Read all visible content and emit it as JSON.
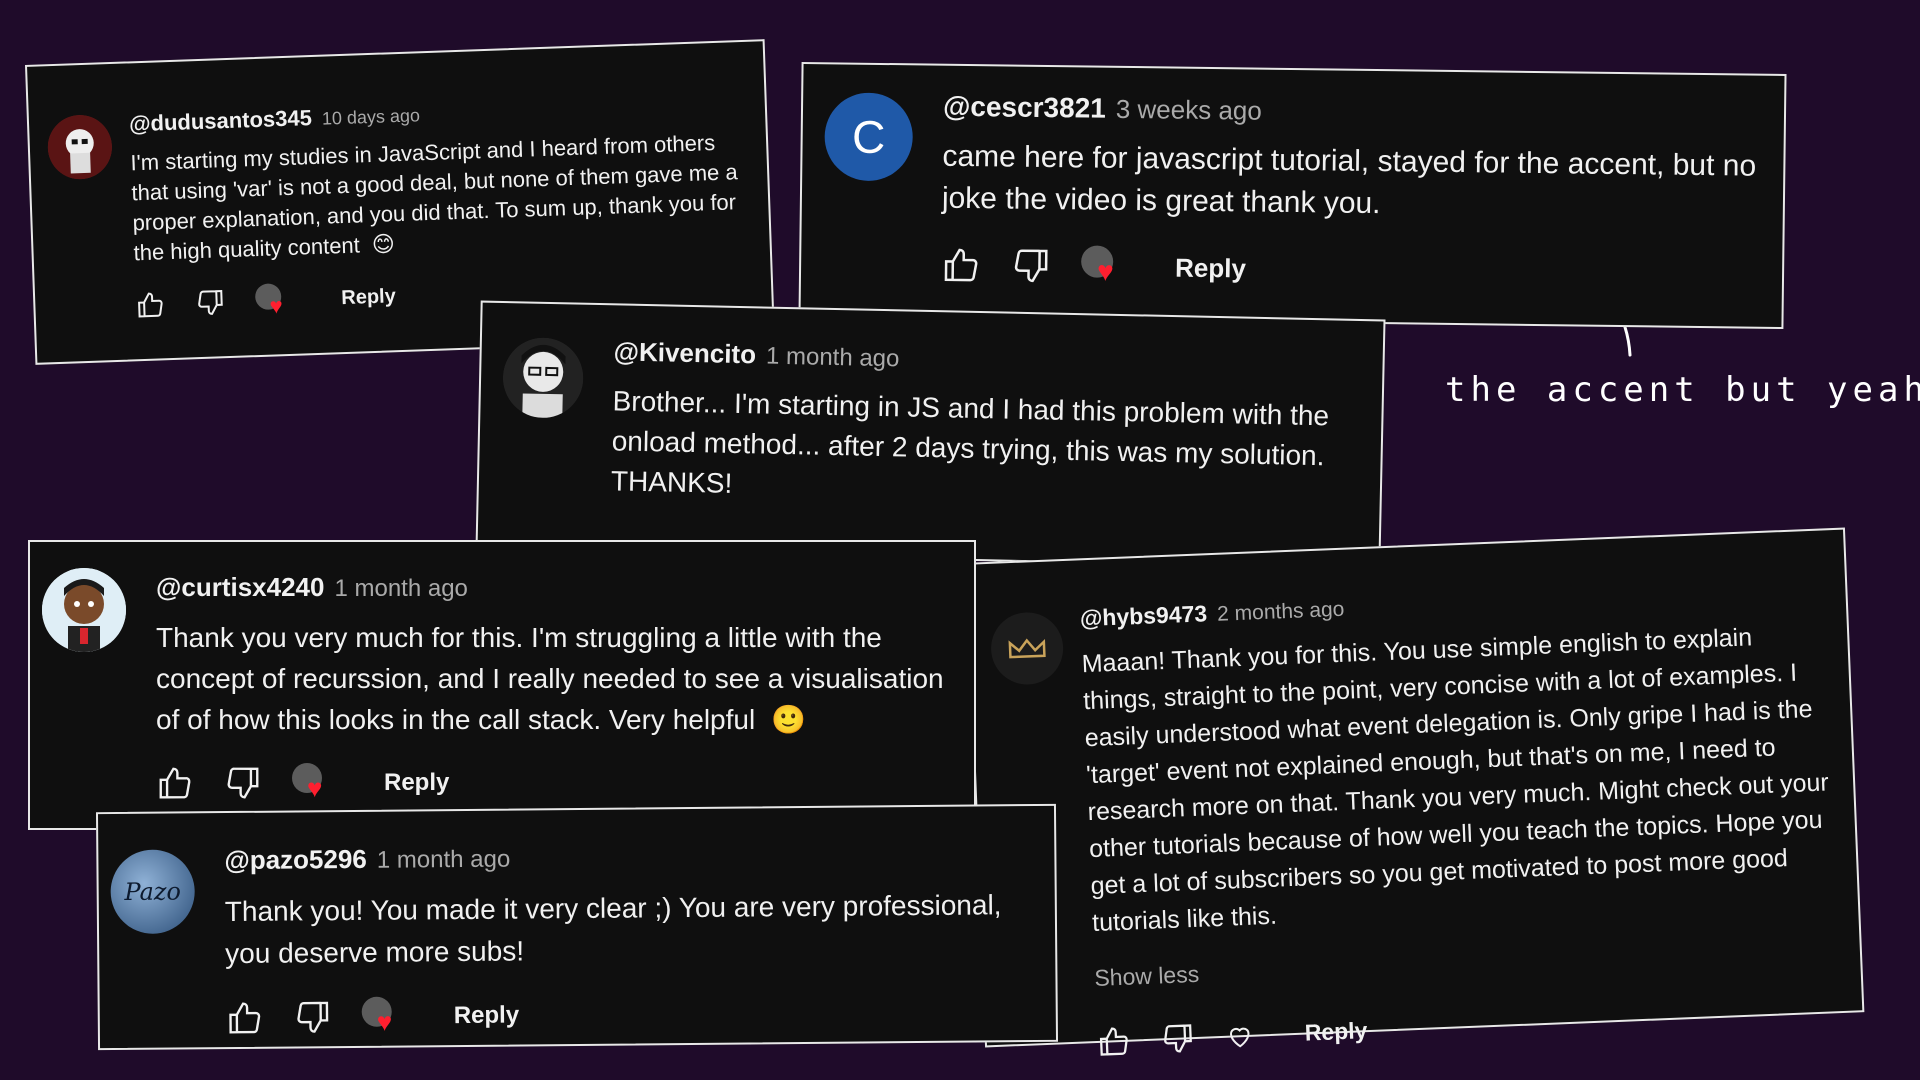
{
  "colors": {
    "background": "#1f0b2a",
    "card": "#0f0f0f",
    "card_border": "#e8e8e8",
    "heart": "#ff1f2f",
    "avatar_c": "#1f59a8"
  },
  "comments": [
    {
      "handle": "@dudusantos345",
      "time": "10 days ago",
      "text": "I'm starting my studies in JavaScript and I heard from others that using 'var' is not a good deal, but none of them gave me a proper explanation, and you did that. To sum up, thank you for the high quality content",
      "emoji": "😊",
      "reply": "Reply"
    },
    {
      "handle": "@cescr3821",
      "time": "3 weeks ago",
      "avatar_letter": "C",
      "text": "came here for javascript tutorial, stayed for the accent, but no joke the video is great thank you.",
      "reply": "Reply"
    },
    {
      "handle": "@Kivencito",
      "time": "1 month ago",
      "text": "Brother... I'm starting in JS and I had this problem with the onload method... after 2 days trying, this was my solution. THANKS!"
    },
    {
      "handle": "@curtisx4240",
      "time": "1 month ago",
      "text": "Thank you very much for this. I'm struggling a little with the concept of recurssion, and I really needed to see a visualisation of of how this looks in the call stack. Very helpful",
      "emoji": "🙂",
      "reply": "Reply"
    },
    {
      "handle": "@pazo5296",
      "time": "1 month ago",
      "avatar_text": "Pazo",
      "text": "Thank you! You made it very clear ;) You are very professional, you deserve more subs!",
      "reply": "Reply"
    },
    {
      "handle": "@hybs9473",
      "time": "2 months ago",
      "text": "Maaan! Thank you for this. You use simple english to explain things, straight to the point, very concise with a lot of examples. I easily understood what event delegation is. Only gripe I had is the 'target' event not explained enough, but that's on me, I need to research more on that. Thank you very much. Might check out your other tutorials because of how well you teach the topics. Hope you get a lot of subscribers so you get motivated to post more good tutorials like this.",
      "show_less": "Show less",
      "reply": "Reply"
    }
  ],
  "annotation": {
    "text": "the accent but yeah",
    "emoji": "😅"
  }
}
